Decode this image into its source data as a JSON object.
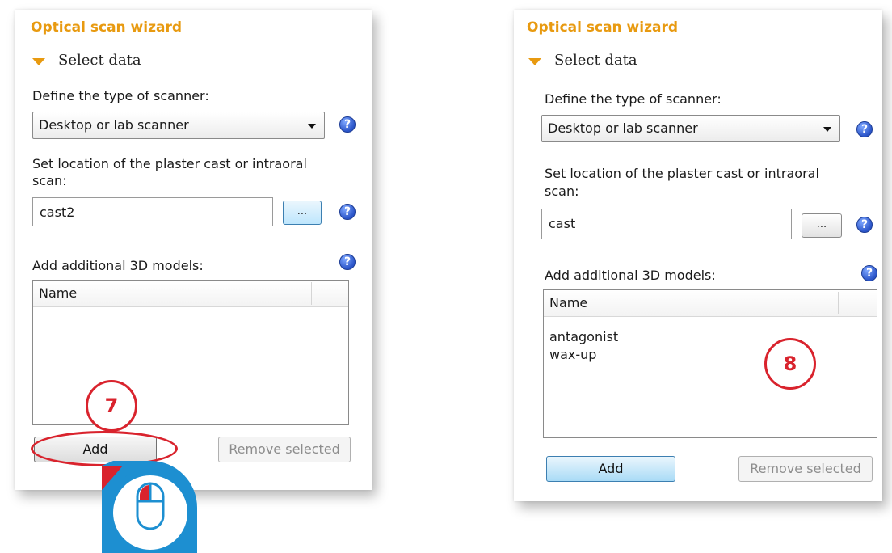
{
  "left_panel": {
    "wizard_title": "Optical scan wizard",
    "section_title": "Select data",
    "scanner_label": "Define the type of scanner:",
    "scanner_value": "Desktop or lab scanner",
    "location_label_line1": "Set location of the plaster cast or intraoral",
    "location_label_line2": "scan:",
    "location_value": "cast2",
    "browse_label": "...",
    "models_label": "Add additional 3D models:",
    "column_name": "Name",
    "items": [],
    "add_label": "Add",
    "remove_label": "Remove selected",
    "step_marker": "7"
  },
  "right_panel": {
    "wizard_title": "Optical scan wizard",
    "section_title": "Select data",
    "scanner_label": "Define the type of scanner:",
    "scanner_value": "Desktop or lab scanner",
    "location_label_line1": "Set location of the plaster cast or intraoral",
    "location_label_line2": "scan:",
    "location_value": "cast",
    "browse_label": "...",
    "models_label": "Add additional 3D models:",
    "column_name": "Name",
    "items": [
      "antagonist",
      "wax-up"
    ],
    "add_label": "Add",
    "remove_label": "Remove selected",
    "step_marker": "8"
  },
  "help_glyph": "?",
  "colors": {
    "title_orange": "#e89a10",
    "marker_red": "#d9232d",
    "mouse_blue": "#1d8fd1",
    "help_blue": "#2b55c9"
  },
  "icons": [
    "expand-triangle-icon",
    "dropdown-arrow-icon",
    "help-icon",
    "mouse-icon"
  ]
}
